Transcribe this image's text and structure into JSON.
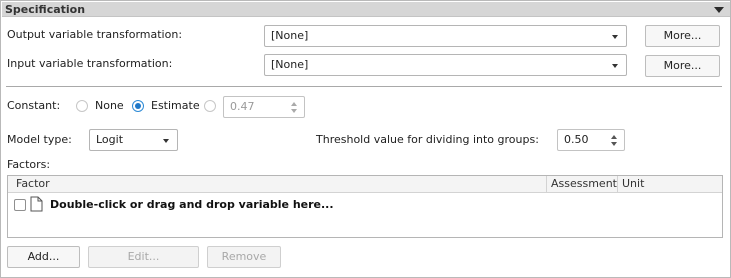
{
  "panel": {
    "title": "Specification"
  },
  "output_transformation": {
    "label": "Output variable transformation:",
    "value": "[None]",
    "more_label": "More..."
  },
  "input_transformation": {
    "label": "Input variable transformation:",
    "value": "[None]",
    "more_label": "More..."
  },
  "constant": {
    "label": "Constant:",
    "options": [
      {
        "label": "None",
        "selected": false
      },
      {
        "label": "Estimate",
        "selected": true
      }
    ],
    "value": "0.47"
  },
  "model_type": {
    "label": "Model type:",
    "value": "Logit"
  },
  "threshold": {
    "label": "Threshold value for dividing into groups:",
    "value": "0.50"
  },
  "factors": {
    "label": "Factors:",
    "columns": [
      "Factor",
      "Assessment",
      "Unit"
    ],
    "placeholder": "Double-click or drag and drop variable here..."
  },
  "buttons": {
    "add": "Add...",
    "edit": "Edit...",
    "remove": "Remove"
  },
  "colors": {
    "accent": "#1f78c8",
    "header_bg": "#d6d6d6"
  }
}
